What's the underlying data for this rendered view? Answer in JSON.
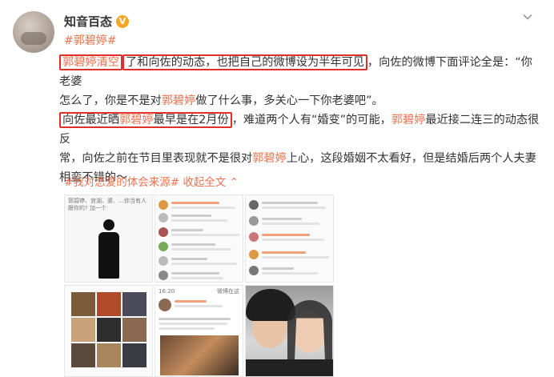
{
  "author": {
    "name": "知音百态",
    "verified_badge": "V"
  },
  "post": {
    "topic_tag": "#郭碧婷#",
    "lines": {
      "l1_box": "郭碧婷清空",
      "l1_a": "了和向佐的动态，也把自己的微博设为半年可见",
      "l1_b": "，向佐的微博下面评论全是：“你老婆",
      "l2_a": "怎么了，你是不是对",
      "l2_name": "郭碧婷",
      "l2_b": "做了什么事，多关心一下你老婆吧”。",
      "l3_box_a": "向佐最近晒",
      "l3_box_name": "郭碧婷",
      "l3_box_b": "最早是在2月份",
      "l3_a": "，难道两个人有“婚变”的可能，",
      "l3_name": "郭碧婷",
      "l3_b": "最近接二连三的动态很反",
      "l4_a": "常，向佐之前在节目里表现就不是很对",
      "l4_name": "郭碧婷",
      "l4_b": "上心，这段婚姻不太看好，但是结婚后两个人夫妻",
      "l5": "相蛮不错的～"
    },
    "source_tag": "#我对恋爱的体会来源#",
    "collapse_label": "收起全文",
    "collapse_icon": "chevron-up-icon"
  },
  "images": {
    "t1_caption": "郭碧婷、宫湖、婆、…你当有人跟你的? 加一个",
    "t5_header": "微博在这",
    "t5_time": "16:20"
  },
  "colors": {
    "accent": "#eb7350",
    "box": "#e0302a",
    "badge": "#f5a623"
  }
}
